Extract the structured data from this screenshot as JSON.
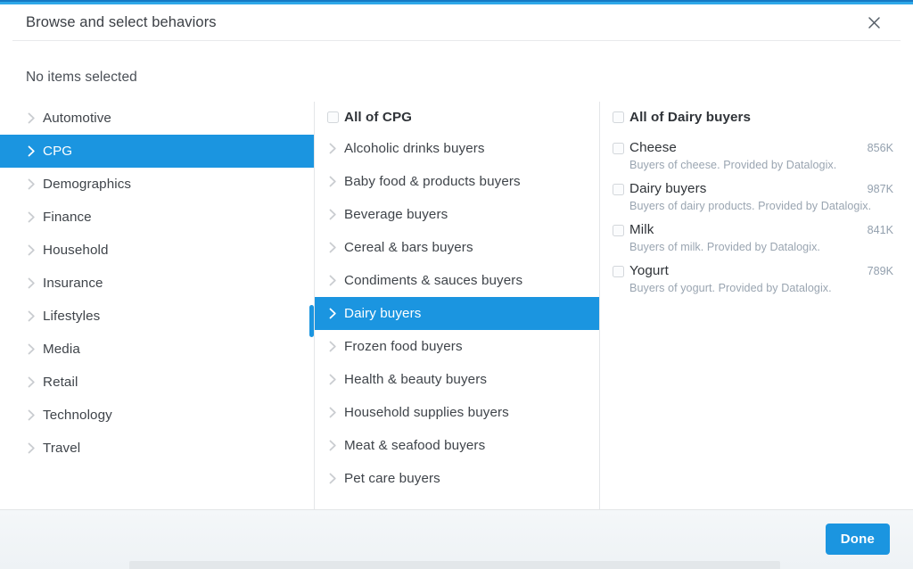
{
  "dialog": {
    "title": "Browse and select behaviors",
    "close_icon": "close-icon",
    "selection_summary": "No items selected"
  },
  "accent_colors": {
    "top_bar_dark": "#1679c4",
    "top_bar_light": "#2ea8e8",
    "highlight": "#1b95e0",
    "primary_button": "#1b95e0",
    "scrollbar": "#1b95e0"
  },
  "categories": {
    "items": [
      {
        "label": "Automotive",
        "selected": false
      },
      {
        "label": "CPG",
        "selected": true
      },
      {
        "label": "Demographics",
        "selected": false
      },
      {
        "label": "Finance",
        "selected": false
      },
      {
        "label": "Household",
        "selected": false
      },
      {
        "label": "Insurance",
        "selected": false
      },
      {
        "label": "Lifestyles",
        "selected": false
      },
      {
        "label": "Media",
        "selected": false
      },
      {
        "label": "Retail",
        "selected": false
      },
      {
        "label": "Technology",
        "selected": false
      },
      {
        "label": "Travel",
        "selected": false
      }
    ]
  },
  "subcategories": {
    "all_label": "All of CPG",
    "all_checked": false,
    "items": [
      {
        "label": "Alcoholic drinks buyers",
        "selected": false
      },
      {
        "label": "Baby food & products buyers",
        "selected": false
      },
      {
        "label": "Beverage buyers",
        "selected": false
      },
      {
        "label": "Cereal & bars buyers",
        "selected": false
      },
      {
        "label": "Condiments & sauces buyers",
        "selected": false
      },
      {
        "label": "Dairy buyers",
        "selected": true
      },
      {
        "label": "Frozen food buyers",
        "selected": false
      },
      {
        "label": "Health & beauty buyers",
        "selected": false
      },
      {
        "label": "Household supplies buyers",
        "selected": false
      },
      {
        "label": "Meat & seafood buyers",
        "selected": false
      },
      {
        "label": "Pet care buyers",
        "selected": false
      }
    ]
  },
  "behaviors": {
    "all_label": "All of Dairy buyers",
    "all_checked": false,
    "items": [
      {
        "name": "Cheese",
        "size": "856K",
        "description": "Buyers of cheese. Provided by Datalogix.",
        "checked": false
      },
      {
        "name": "Dairy buyers",
        "size": "987K",
        "description": "Buyers of dairy products. Provided by Datalogix.",
        "checked": false
      },
      {
        "name": "Milk",
        "size": "841K",
        "description": "Buyers of milk. Provided by Datalogix.",
        "checked": false
      },
      {
        "name": "Yogurt",
        "size": "789K",
        "description": "Buyers of yogurt. Provided by Datalogix.",
        "checked": false
      }
    ]
  },
  "footer": {
    "done_label": "Done"
  }
}
